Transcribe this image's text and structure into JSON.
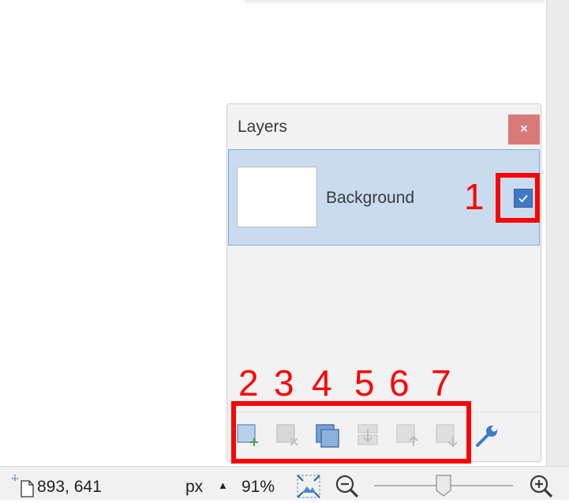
{
  "layers_panel": {
    "title": "Layers",
    "close_glyph": "×",
    "layers": [
      {
        "name": "Background",
        "visible": true
      }
    ],
    "toolbar_icons": [
      "add-layer-icon",
      "delete-layer-icon",
      "duplicate-layer-icon",
      "merge-layer-down-icon",
      "move-layer-up-icon",
      "move-layer-down-icon",
      "layer-properties-icon"
    ]
  },
  "annotations": {
    "labels": [
      "1",
      "2",
      "3",
      "4",
      "5",
      "6",
      "7"
    ],
    "color": "#ff0000"
  },
  "status_bar": {
    "image_size": "893, 641",
    "units": "px",
    "units_arrow": "▲",
    "zoom": "91%",
    "zoom_slider_fraction": 0.5
  },
  "colors": {
    "accent": "#4279c6",
    "selected_row": "#c9dcef",
    "close_button": "#d97a7a",
    "disabled_icon": "#c8c8c8"
  }
}
